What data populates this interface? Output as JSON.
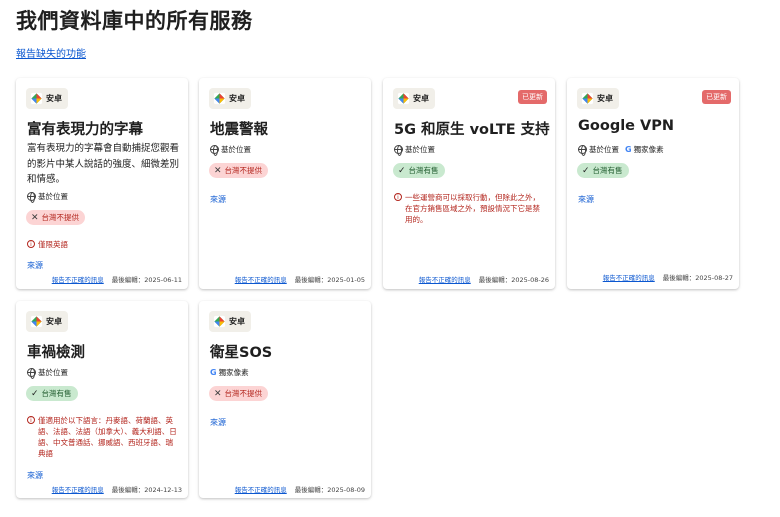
{
  "page": {
    "title": "我們資料庫中的所有服務",
    "report_missing": "報告缺失的功能"
  },
  "common": {
    "platform": "安卓",
    "updated_badge": "已更新",
    "location": "基於位置",
    "pixel_exclusive": "獨家像素",
    "not_available": "台灣不提供",
    "available": "台灣有售",
    "source": "來源",
    "report_incorrect": "報告不正確的訊息"
  },
  "cards": [
    {
      "title": "富有表現力的字幕",
      "description": "富有表現力的字幕會自動捕捉您觀看的影片中某人說話的強度、細微差別和情感。",
      "note": "僅限英語",
      "last_edited": "最後編輯：2025-06-11"
    },
    {
      "title": "地震警報",
      "last_edited": "最後編輯：2025-01-05"
    },
    {
      "title": "5G 和原生 voLTE 支持",
      "note": "一些運營商可以採取行動，但除此之外，在官方銷售區域之外，預設情況下它是禁用的。",
      "last_edited": "最後編輯：2025-08-26"
    },
    {
      "title": "Google VPN",
      "last_edited": "最後編輯：2025-08-27"
    },
    {
      "title": "車禍檢測",
      "note": "僅適用於以下語言：丹麥語、荷蘭語、英語、法語、法語（加拿大）、義大利語、日語、中文普通話、挪威語、西班牙語、瑞典語",
      "last_edited": "最後編輯：2024-12-13"
    },
    {
      "title": "衛星SOS",
      "last_edited": "最後編輯：2025-08-09"
    }
  ],
  "colors": {
    "link": "#0b57d0",
    "updated_badge": "#e46a6a",
    "unavailable_bg": "#fcd4d4",
    "available_bg": "#c9e9cf",
    "warning_text": "#b3261e"
  },
  "icons": [
    "android-logo-icon",
    "globe-icon",
    "google-g-icon",
    "x-mark-icon",
    "check-mark-icon",
    "info-icon"
  ]
}
